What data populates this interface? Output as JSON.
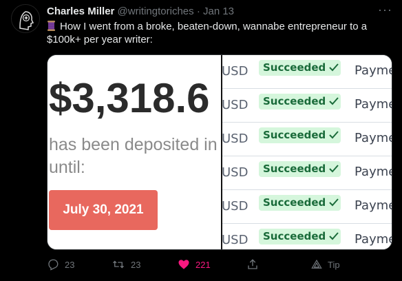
{
  "tweet": {
    "author_name": "Charles Miller",
    "handle": "@writingtoriches",
    "separator": "·",
    "date": "Jan 13",
    "text": "How I went from a broke, beaten-down, wannabe entrepreneur to a $100k+ per year writer:",
    "more_label": "···"
  },
  "media": {
    "amount": "$3,318.6",
    "deposited_text": "has been deposited in y",
    "until_text": "until:",
    "date_button": "July 30, 2021",
    "date_button_color": "#e8685e",
    "rows": [
      {
        "currency": "USD",
        "status": "Succeeded",
        "type": "Payme"
      },
      {
        "currency": "USD",
        "status": "Succeeded",
        "type": "Payme"
      },
      {
        "currency": "USD",
        "status": "Succeeded",
        "type": "Payme"
      },
      {
        "currency": "USD",
        "status": "Succeeded",
        "type": "Payme"
      },
      {
        "currency": "USD",
        "status": "Succeeded",
        "type": "Payme"
      },
      {
        "currency": "USD",
        "status": "Succeeded",
        "type": "Payme"
      }
    ]
  },
  "actions": {
    "replies": "23",
    "retweets": "23",
    "likes": "221",
    "tip_label": "Tip"
  },
  "colors": {
    "like_accent": "#f91880",
    "status_bg": "#d5f6dc",
    "status_text": "#1a6b3a"
  },
  "icons": [
    "spool-emoji",
    "reply-icon",
    "retweet-icon",
    "heart-icon",
    "share-icon",
    "tip-icon",
    "more-icon"
  ]
}
